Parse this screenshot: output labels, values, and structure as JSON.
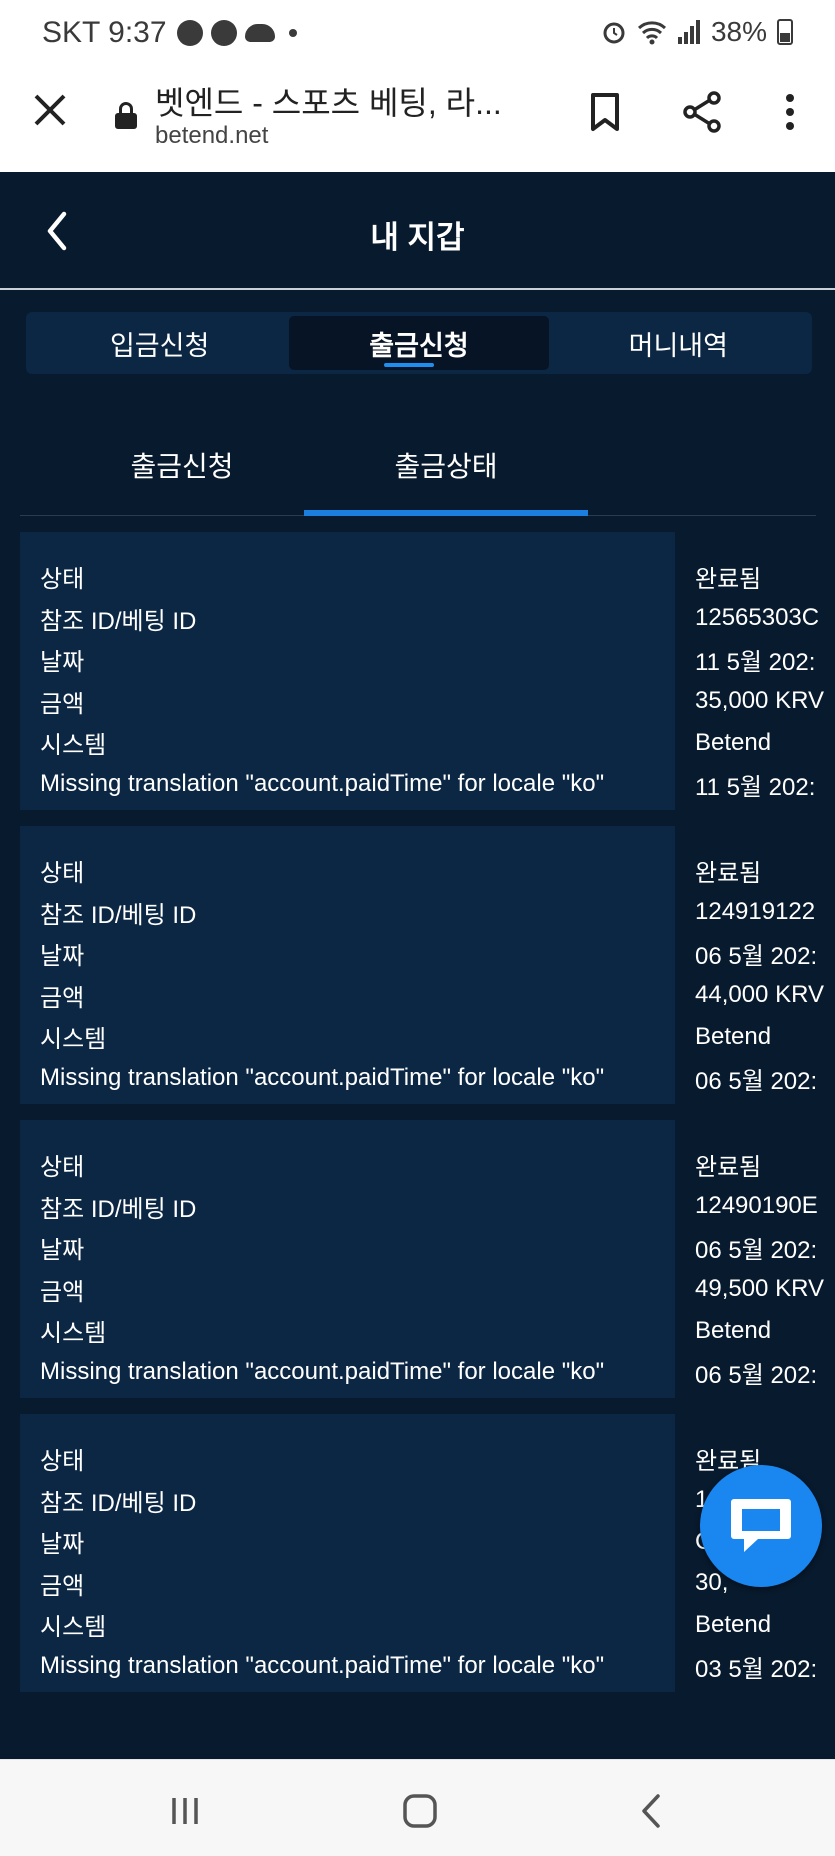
{
  "status_bar": {
    "carrier_time": "SKT 9:37",
    "battery": "38%"
  },
  "browser": {
    "title": "벳엔드 - 스포츠 베팅, 라...",
    "domain": "betend.net"
  },
  "header": {
    "title": "내 지갑"
  },
  "segments": [
    {
      "label": "입금신청",
      "active": false
    },
    {
      "label": "출금신청",
      "active": true
    },
    {
      "label": "머니내역",
      "active": false
    }
  ],
  "subtabs": [
    {
      "label": "출금신청",
      "active": false
    },
    {
      "label": "출금상태",
      "active": true
    }
  ],
  "field_labels": {
    "status": "상태",
    "ref_id": "참조 ID/베팅 ID",
    "date": "날짜",
    "amount": "금액",
    "system": "시스템",
    "paid_time": "Missing translation \"account.paidTime\" for locale \"ko\""
  },
  "transactions": [
    {
      "status": "완료됨",
      "ref_id": "12565303C",
      "date": "11 5월 202:",
      "amount": "35,000 KRV",
      "system": "Betend",
      "paid_time": "11 5월 202:"
    },
    {
      "status": "완료됨",
      "ref_id": "124919122",
      "date": "06 5월 202:",
      "amount": "44,000 KRV",
      "system": "Betend",
      "paid_time": "06 5월 202:"
    },
    {
      "status": "완료됨",
      "ref_id": "12490190E",
      "date": "06 5월 202:",
      "amount": "49,500 KRV",
      "system": "Betend",
      "paid_time": "06 5월 202:"
    },
    {
      "status": "완료됨",
      "ref_id": "1",
      "date": "C",
      "amount": "30,",
      "system": "Betend",
      "paid_time": "03 5월 202:"
    }
  ],
  "colors": {
    "app_bg": "#081a2d",
    "card_bg": "#0c2744",
    "accent": "#1b7fe0",
    "chat_fab": "#1a86f0"
  }
}
